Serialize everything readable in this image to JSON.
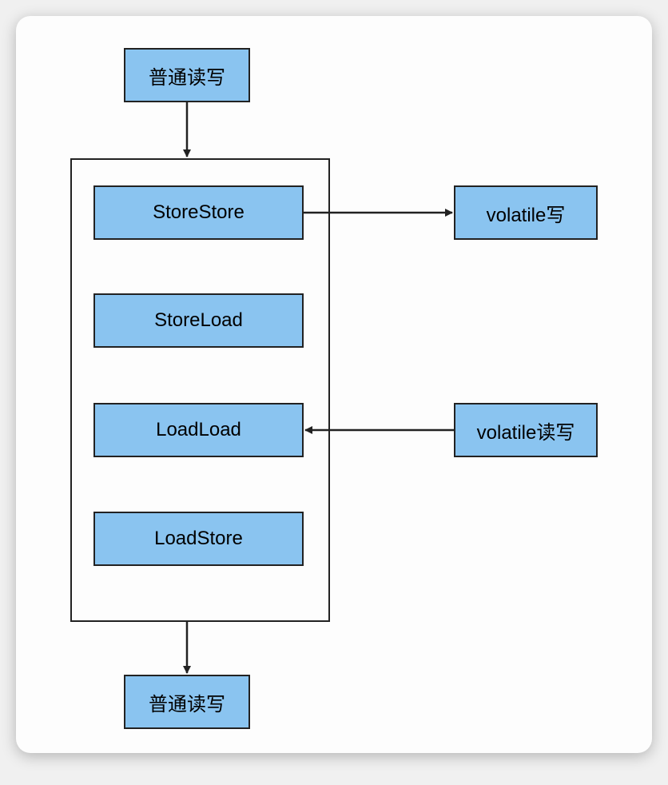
{
  "boxes": {
    "top": "普通读写",
    "store_store": "StoreStore",
    "store_load": "StoreLoad",
    "load_load": "LoadLoad",
    "load_store": "LoadStore",
    "volatile_write": "volatile写",
    "volatile_rw": "volatile读写",
    "bottom": "普通读写"
  },
  "colors": {
    "box_fill": "#8ac4f0",
    "box_border": "#222222"
  }
}
